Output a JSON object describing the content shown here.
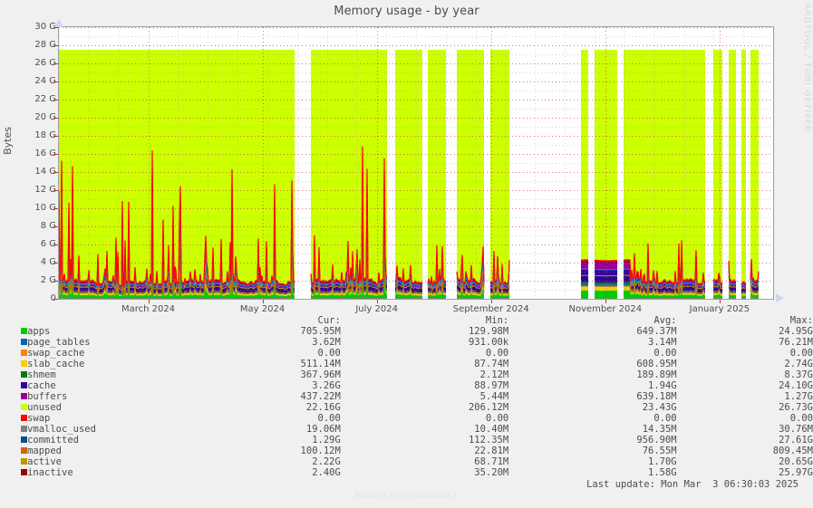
{
  "header": {
    "title": "Memory usage - by year",
    "watermark": "RRDTOOL / TOBI OETIKER"
  },
  "footer": {
    "version": "Munin 2.0.37-1ubuntu0.1",
    "last_update": "Last update: Mon Mar  3 06:30:03 2025"
  },
  "chart_data": {
    "type": "area",
    "title": "Memory usage - by year",
    "xlabel": "",
    "ylabel": "Bytes",
    "ylim": [
      0,
      30
    ],
    "yunit": "G",
    "grid": true,
    "legend_position": "below",
    "ytick_labels": [
      "30 G",
      "28 G",
      "26 G",
      "24 G",
      "22 G",
      "20 G",
      "18 G",
      "16 G",
      "14 G",
      "12 G",
      "10 G",
      "8 G",
      "6 G",
      "4 G",
      "2 G",
      "0"
    ],
    "ytick_values": [
      30,
      28,
      26,
      24,
      22,
      20,
      18,
      16,
      14,
      12,
      10,
      8,
      6,
      4,
      2,
      0
    ],
    "xtick_labels": [
      "March 2024",
      "May 2024",
      "July 2024",
      "September 2024",
      "November 2024",
      "January 2025"
    ],
    "xtick_fracs": [
      0.125,
      0.285,
      0.445,
      0.605,
      0.765,
      0.925
    ],
    "total_stack_top_g": 27.5,
    "series": [
      {
        "name": "apps",
        "color": "#00cc00",
        "cur": "705.95M",
        "min": "129.98M",
        "avg": "649.37M",
        "max": "24.95G"
      },
      {
        "name": "page_tables",
        "color": "#0066b3",
        "cur": "3.62M",
        "min": "931.00k",
        "avg": "3.14M",
        "max": "76.21M"
      },
      {
        "name": "swap_cache",
        "color": "#ff8000",
        "cur": "0.00",
        "min": "0.00",
        "avg": "0.00",
        "max": "0.00"
      },
      {
        "name": "slab_cache",
        "color": "#ffcc00",
        "cur": "511.14M",
        "min": "87.74M",
        "avg": "608.95M",
        "max": "2.74G"
      },
      {
        "name": "shmem",
        "color": "#330099",
        "swatch_color": "#008000",
        "cur": "367.96M",
        "min": "2.12M",
        "avg": "189.89M",
        "max": "8.37G"
      },
      {
        "name": "cache",
        "color": "#330099",
        "cur": "3.26G",
        "min": "88.97M",
        "avg": "1.94G",
        "max": "24.10G"
      },
      {
        "name": "buffers",
        "color": "#990099",
        "cur": "437.22M",
        "min": "5.44M",
        "avg": "639.18M",
        "max": "1.27G"
      },
      {
        "name": "unused",
        "color": "#ccff00",
        "cur": "22.16G",
        "min": "206.12M",
        "avg": "23.43G",
        "max": "26.73G"
      },
      {
        "name": "swap",
        "color": "#ff0000",
        "cur": "0.00",
        "min": "0.00",
        "avg": "0.00",
        "max": "0.00"
      },
      {
        "name": "vmalloc_used",
        "color": "#808080",
        "cur": "19.06M",
        "min": "10.40M",
        "avg": "14.35M",
        "max": "30.76M"
      },
      {
        "name": "committed",
        "color": "#008fee",
        "swatch_color": "#00557f",
        "cur": "1.29G",
        "min": "112.35M",
        "avg": "956.90M",
        "max": "27.61G"
      },
      {
        "name": "mapped",
        "color": "#cc6600",
        "cur": "100.12M",
        "min": "22.81M",
        "avg": "76.55M",
        "max": "809.45M"
      },
      {
        "name": "active",
        "color": "#bb9900",
        "cur": "2.22G",
        "min": "68.71M",
        "avg": "1.70G",
        "max": "20.65G"
      },
      {
        "name": "inactive",
        "color": "#990000",
        "cur": "2.40G",
        "min": "35.20M",
        "avg": "1.58G",
        "max": "25.97G"
      }
    ],
    "columns": {
      "name": "",
      "cur": "Cur:",
      "min": "Min:",
      "avg": "Avg:",
      "max": "Max:"
    },
    "data_gaps_fracs": [
      [
        0.33,
        0.352
      ],
      [
        0.46,
        0.47
      ],
      [
        0.51,
        0.516
      ],
      [
        0.542,
        0.556
      ],
      [
        0.596,
        0.604
      ],
      [
        0.631,
        0.73
      ],
      [
        0.742,
        0.75
      ],
      [
        0.782,
        0.79
      ],
      [
        0.905,
        0.915
      ],
      [
        0.93,
        0.937
      ],
      [
        0.948,
        0.955
      ],
      [
        0.962,
        0.968
      ],
      [
        0.98,
        1.0
      ]
    ]
  }
}
